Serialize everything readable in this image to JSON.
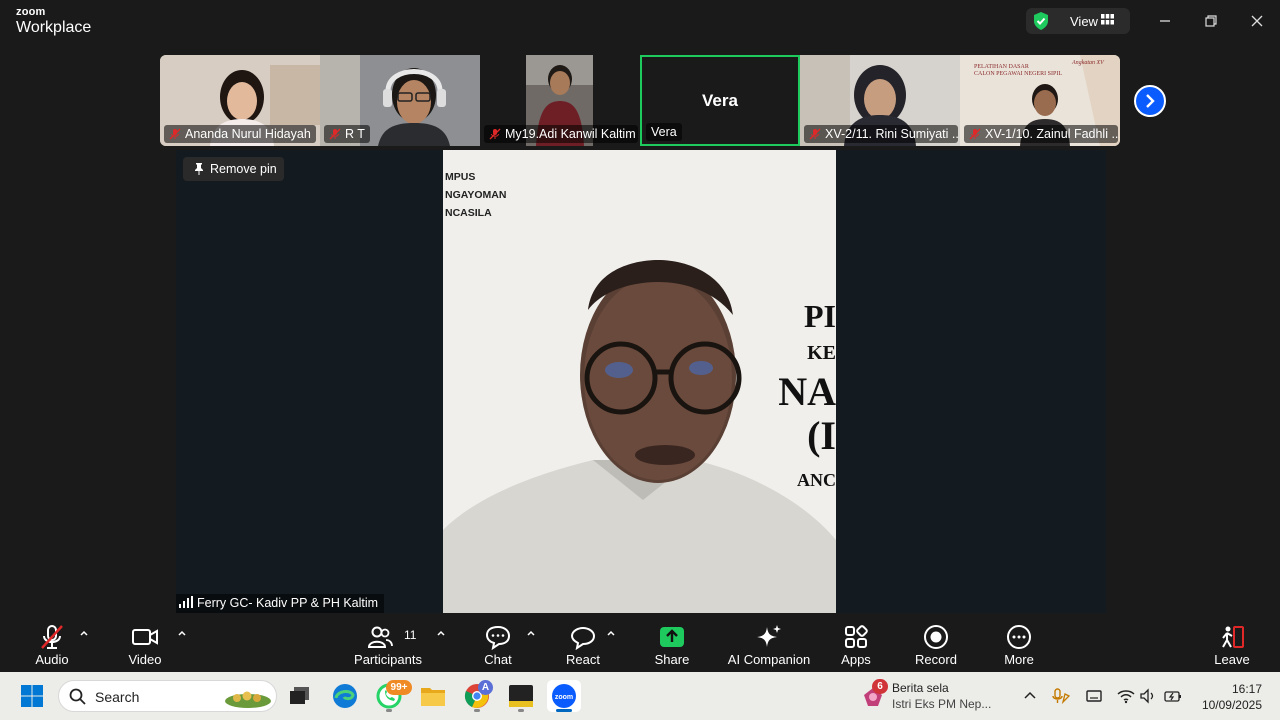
{
  "app": {
    "brand_top": "zoom",
    "brand_bottom": "Workplace",
    "view_label": "View"
  },
  "colors": {
    "accent": "#0b5cff",
    "active_border": "#1ec95e",
    "mute_red": "#e02828",
    "share_green": "#1ec95e"
  },
  "participants_strip": [
    {
      "name": "Ananda Nurul Hidayah",
      "muted": true
    },
    {
      "name": "R T",
      "muted": true
    },
    {
      "name": "My19.Adi Kanwil Kaltim",
      "muted": true
    },
    {
      "name": "Vera",
      "muted": false,
      "video_off": true,
      "big_name": "Vera"
    },
    {
      "name": "XV-2/11. Rini Sumiyati ...",
      "muted": true
    },
    {
      "name": "XV-1/10. Zainul Fadhli ...",
      "muted": true
    }
  ],
  "stage": {
    "pin_button": "Remove pin",
    "speaker_name": "Ferry GC- Kadiv PP & PH Kaltim",
    "background_text_left": [
      "MPUS",
      "NGAYOMAN",
      "NCASILA"
    ],
    "background_text_right": [
      "PI",
      "KE",
      "NA",
      "(I",
      "ANC"
    ]
  },
  "thumbnail_overlay_text": {
    "slide_line1": "PELATIHAN DASAR",
    "slide_line2": "CALON PEGAWAI NEGERI SIPIL",
    "slide_badge": "Angkatan XV"
  },
  "toolbar": {
    "audio": "Audio",
    "video": "Video",
    "participants": "Participants",
    "participants_count": "11",
    "chat": "Chat",
    "react": "React",
    "share": "Share",
    "ai_companion": "AI Companion",
    "apps": "Apps",
    "record": "Record",
    "more": "More",
    "leave": "Leave"
  },
  "taskbar": {
    "search_label": "Search",
    "whatsapp_badge": "99+",
    "chrome_badge": "A",
    "news_badge": "6",
    "news_title": "Berita sela",
    "news_subtitle": "Istri Eks PM Nep...",
    "time": "16:17",
    "date": "10/09/2025"
  }
}
